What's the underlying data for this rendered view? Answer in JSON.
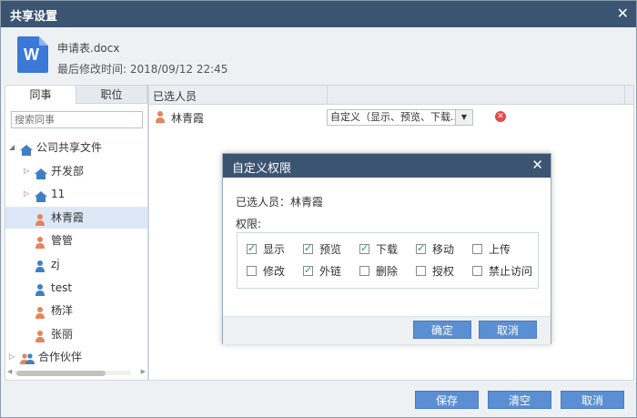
{
  "window": {
    "title": "共享设置",
    "close": "✕"
  },
  "file": {
    "name": "申请表.docx",
    "modified": "最后修改时间:  2018/09/12 22:45",
    "icon_letter": "W"
  },
  "left": {
    "tabs": [
      "同事",
      "职位"
    ],
    "search_placeholder": "搜索同事",
    "tree": [
      {
        "label": "公司共享文件",
        "type": "house",
        "level": 0,
        "arrow": "◢"
      },
      {
        "label": "开发部",
        "type": "house",
        "level": 1,
        "arrow": "▷"
      },
      {
        "label": "11",
        "type": "house",
        "level": 1,
        "arrow": "▷"
      },
      {
        "label": "林青霞",
        "type": "person-female",
        "level": 1,
        "selected": true
      },
      {
        "label": "管管",
        "type": "person-female",
        "level": 1
      },
      {
        "label": "zj",
        "type": "person-male",
        "level": 1
      },
      {
        "label": "test",
        "type": "person-male",
        "level": 1
      },
      {
        "label": "杨洋",
        "type": "person-female",
        "level": 1
      },
      {
        "label": "张丽",
        "type": "person-female",
        "level": 1
      },
      {
        "label": "合作伙伴",
        "type": "group",
        "level": 0,
        "arrow": "▷"
      }
    ]
  },
  "right": {
    "header": "已选人员",
    "rows": [
      {
        "name": "林青霞",
        "permission": "自定义（显示、预览、下载..."
      }
    ]
  },
  "modal": {
    "title": "自定义权限",
    "close": "✕",
    "selected": "已选人员：林青霞",
    "perm_label": "权限:",
    "permissions": [
      {
        "label": "显示",
        "checked": true
      },
      {
        "label": "预览",
        "checked": true
      },
      {
        "label": "下载",
        "checked": true
      },
      {
        "label": "移动",
        "checked": true
      },
      {
        "label": "上传",
        "checked": false
      },
      {
        "label": "修改",
        "checked": false
      },
      {
        "label": "外链",
        "checked": true
      },
      {
        "label": "删除",
        "checked": false
      },
      {
        "label": "授权",
        "checked": false
      },
      {
        "label": "禁止访问",
        "checked": false
      }
    ],
    "ok": "确定",
    "cancel": "取消"
  },
  "footer": {
    "save": "保存",
    "clear": "清空",
    "cancel": "取消"
  },
  "colors": {
    "titlebar": "#3b5472",
    "button": "#5b8fd4",
    "female": "#e8825a",
    "male": "#3f7fc4",
    "selected_row": "#dce8f7"
  }
}
